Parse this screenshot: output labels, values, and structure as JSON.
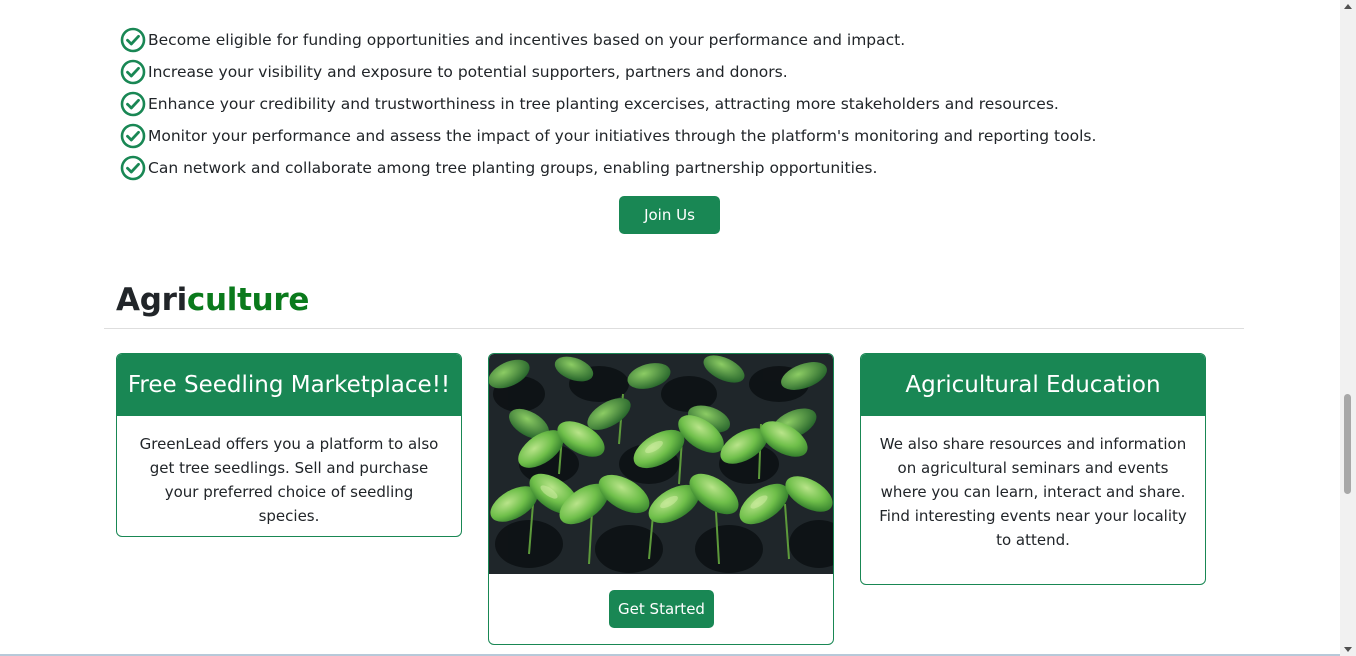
{
  "benefits": [
    "Become eligible for funding opportunities and incentives based on your performance and impact.",
    "Increase your visibility and exposure to potential supporters, partners and donors.",
    "Enhance your credibility and trustworthiness in tree planting excercises, attracting more stakeholders and resources.",
    "Monitor your performance and assess the impact of your initiatives through the platform's monitoring and reporting tools.",
    "Can network and collaborate among tree planting groups, enabling partnership opportunities."
  ],
  "join_button": "Join Us",
  "section": {
    "title_part1": "Agri",
    "title_part2": "culture"
  },
  "cards": [
    {
      "header": "Free Seedling Marketplace!!",
      "body": "GreenLead offers you a platform to also get tree seedlings. Sell and purchase your preferred choice of seedling species."
    },
    {
      "image": "seedlings-photo",
      "button": "Get Started"
    },
    {
      "header": "Agricultural Education",
      "body": "We also share resources and information on agricultural seminars and events where you can learn, interact and share. Find interesting events near your locality to attend."
    }
  ],
  "colors": {
    "brand_green": "#198754",
    "title_accent": "#0a7a1c"
  },
  "icons": {
    "benefit_icon": "check-circle-icon"
  }
}
